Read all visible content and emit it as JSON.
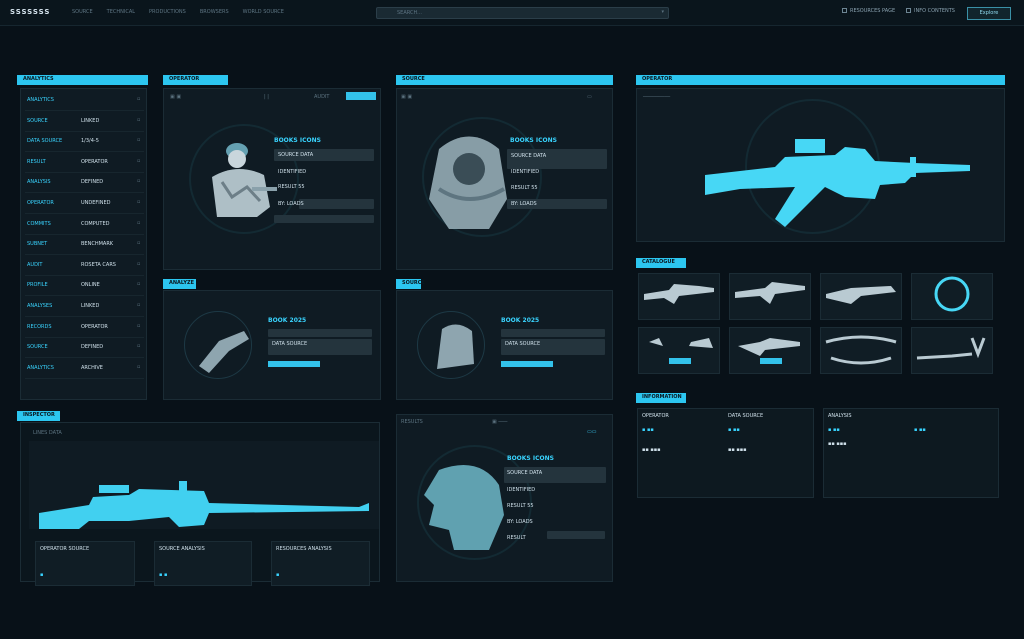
{
  "app": {
    "logo": "SSSSSSS",
    "nav": [
      "SOURCE",
      "TECHNICAL",
      "PRODUCTIONS",
      "BROWSERS",
      "WORLD SOURCE"
    ]
  },
  "search": {
    "placeholder": "SEARCH..."
  },
  "topright": {
    "link1": "RESOURCES PAGE",
    "link2": "INFO CONTENTS",
    "button": "Explore"
  },
  "sidebar": {
    "header": "ANALYTICS",
    "items": [
      {
        "label": "ANALYTICS",
        "value": ""
      },
      {
        "label": "SOURCE",
        "value": "LINKED"
      },
      {
        "label": "DATA SOURCE",
        "value": "1/3/4-5"
      },
      {
        "label": "RESULT",
        "value": "OPERATOR"
      },
      {
        "label": "ANALYSIS",
        "value": "DEFINED"
      },
      {
        "label": "OPERATOR",
        "value": "UNDEFINED"
      },
      {
        "label": "COMMITS",
        "value": "COMPUTED"
      },
      {
        "label": "SUBNET",
        "value": "BENCHMARK"
      },
      {
        "label": "AUDIT",
        "value": "ROSETA CARS"
      },
      {
        "label": "PROFILE",
        "value": "ONLINE"
      },
      {
        "label": "ANALYSES",
        "value": "LINKED"
      },
      {
        "label": "RECORDS",
        "value": "OPERATOR"
      },
      {
        "label": "SOURCE",
        "value": "DEFINED"
      },
      {
        "label": "ANALYTICS",
        "value": "ARCHIVE"
      }
    ]
  },
  "card1": {
    "header": "OPERATOR",
    "title": "BOOKS ICONS",
    "rows": [
      "SOURCE DATA",
      "IDENTIFIED",
      "RESULT 55",
      "BY: LOADS",
      "TAB"
    ],
    "tab_label": "AUDIT"
  },
  "card2": {
    "header": "SOURCE",
    "title": "BOOKS ICONS",
    "rows": [
      "SOURCE DATA",
      "IDENTIFIED",
      "RESULT 55",
      "BY: LOADS"
    ]
  },
  "card3": {
    "header": "ANALYZE",
    "title": "BOOK 2025",
    "rows": [
      "DATA SOURCE",
      "BLOCK"
    ]
  },
  "card4": {
    "header": "SOURCE",
    "title": "BOOK 2025",
    "rows": [
      "DATA SOURCE",
      "BLOCK"
    ]
  },
  "card5": {
    "header": "RESULTS",
    "title": "BOOKS ICONS",
    "rows": [
      "SOURCE DATA",
      "IDENTIFIED",
      "RESULT 55",
      "BY: LOADS",
      "RESULT"
    ]
  },
  "rifle_panel": {
    "header": "OPERATOR"
  },
  "thumbs": {
    "header": "CATALOGUE"
  },
  "bottom_left": {
    "header": "INSPECTOR",
    "subtitle": "LINES DATA",
    "cards": [
      "OPERATOR SOURCE",
      "SOURCE ANALYSIS",
      "RESOURCES ANALYSIS"
    ]
  },
  "bottom_right": {
    "header": "INFORMATION",
    "cols": [
      "OPERATOR",
      "DATA SOURCE",
      "ANALYSIS"
    ]
  }
}
